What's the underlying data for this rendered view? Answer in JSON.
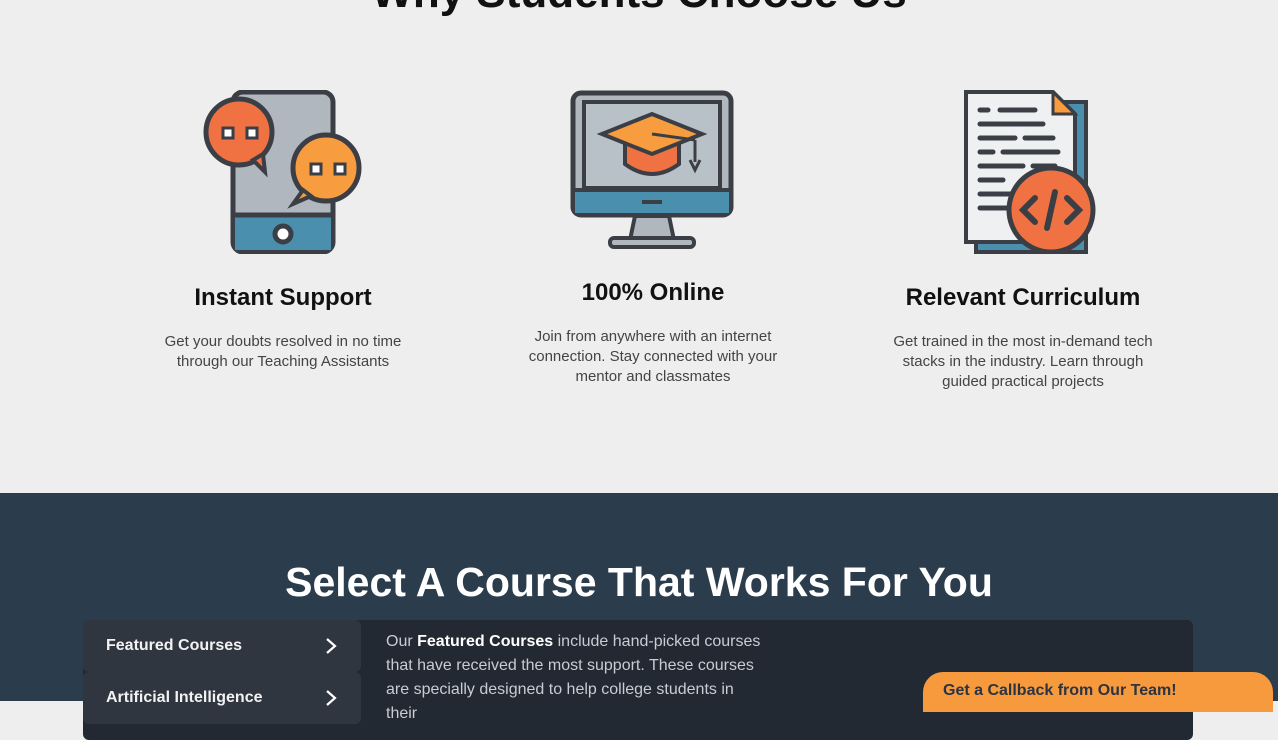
{
  "why": {
    "title": "Why Students Choose Us",
    "features": [
      {
        "icon": "chat-tablet-icon",
        "title": "Instant Support",
        "text": "Get your doubts resolved in no time through our Teaching Assistants"
      },
      {
        "icon": "graduation-monitor-icon",
        "title": "100% Online",
        "text": "Join from anywhere with an internet connection. Stay connected with your mentor and classmates"
      },
      {
        "icon": "code-document-icon",
        "title": "Relevant Curriculum",
        "text": "Get trained in the most in-demand tech stacks in the industry. Learn through guided practical projects"
      }
    ]
  },
  "courses": {
    "title": "Select A Course That Works For You",
    "tabs": [
      {
        "label": "Featured Courses",
        "icon": "chevron-right-icon"
      },
      {
        "label": "Artificial Intelligence",
        "icon": "chevron-right-icon"
      }
    ],
    "description": {
      "prefix": "Our ",
      "highlight": "Featured Courses",
      "suffix": " include hand-picked courses that have received the most support. These courses are specially designed to help college students in their"
    }
  },
  "callback": {
    "label": "Get a Callback from Our Team!"
  },
  "colors": {
    "accent": "#f79a3e",
    "dark_section": "#2b3c4c",
    "panel": "#222933"
  }
}
